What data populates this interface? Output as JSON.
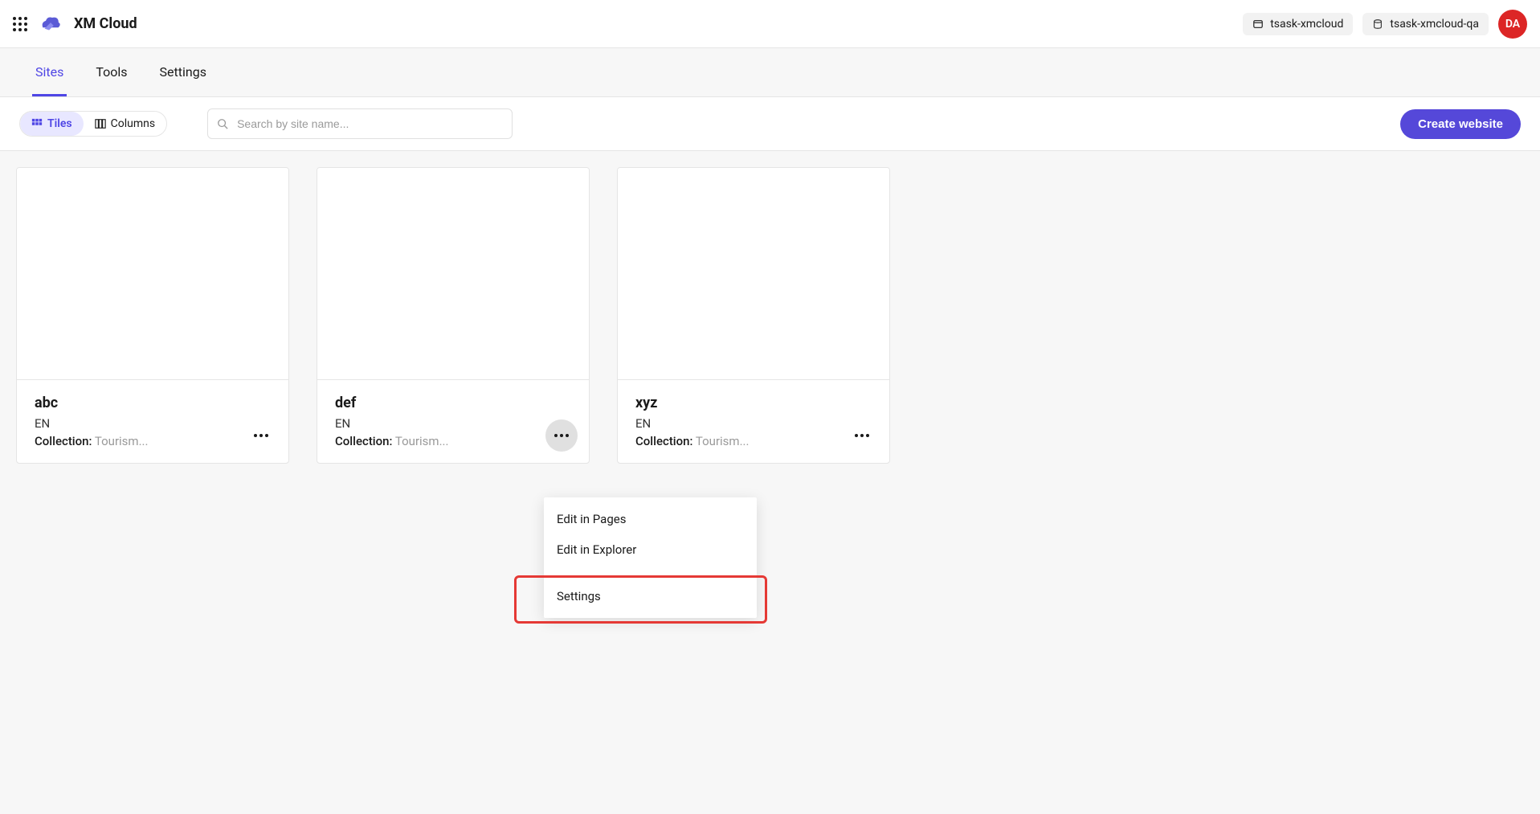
{
  "header": {
    "app_title": "XM Cloud",
    "org_1": "tsask-xmcloud",
    "org_2": "tsask-xmcloud-qa",
    "avatar_initials": "DA"
  },
  "tabs": {
    "items": [
      {
        "label": "Sites",
        "active": true
      },
      {
        "label": "Tools",
        "active": false
      },
      {
        "label": "Settings",
        "active": false
      }
    ]
  },
  "toolbar": {
    "view_tiles": "Tiles",
    "view_columns": "Columns",
    "search_placeholder": "Search by site name...",
    "create_button": "Create website"
  },
  "cards": [
    {
      "name": "abc",
      "lang": "EN",
      "collection_label": "Collection:",
      "collection_value": "Tourism...",
      "menu_open": false
    },
    {
      "name": "def",
      "lang": "EN",
      "collection_label": "Collection:",
      "collection_value": "Tourism...",
      "menu_open": true
    },
    {
      "name": "xyz",
      "lang": "EN",
      "collection_label": "Collection:",
      "collection_value": "Tourism...",
      "menu_open": false
    }
  ],
  "context_menu": {
    "items": [
      {
        "label": "Edit in Pages"
      },
      {
        "label": "Edit in Explorer"
      },
      {
        "label": "Settings"
      }
    ]
  }
}
